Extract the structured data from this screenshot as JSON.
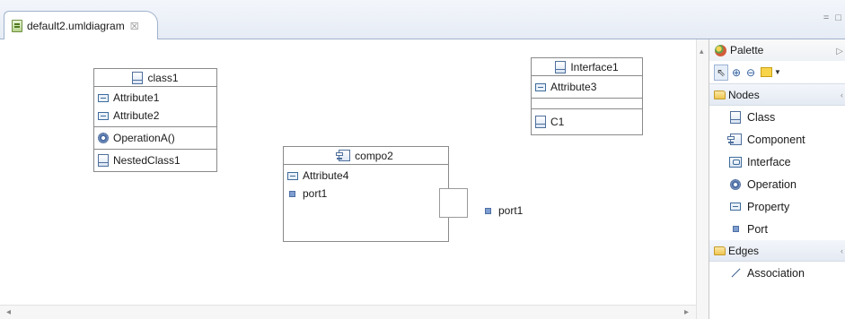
{
  "editor": {
    "tab_title": "default2.umldiagram",
    "tab_close_icon": "close-x-icon",
    "window_controls": "= □"
  },
  "diagram": {
    "class1": {
      "name": "class1",
      "attributes": [
        "Attribute1",
        "Attribute2"
      ],
      "operations": [
        "OperationA()"
      ],
      "nested_classes": [
        "NestedClass1"
      ]
    },
    "interface1": {
      "name": "Interface1",
      "attributes": [
        "Attribute3"
      ],
      "operations": [],
      "nested_classes": [
        "C1"
      ]
    },
    "compo2": {
      "name": "compo2",
      "attributes": [
        "Attribute4"
      ],
      "ports": [
        "port1"
      ]
    },
    "free_port": {
      "label": "port1"
    }
  },
  "palette": {
    "title": "Palette",
    "tools": [
      "select-arrow-icon",
      "zoom-in-icon",
      "zoom-out-icon",
      "note-icon"
    ],
    "nodes_drawer": {
      "label": "Nodes",
      "items": [
        {
          "label": "Class",
          "icon": "class-icon"
        },
        {
          "label": "Component",
          "icon": "component-icon"
        },
        {
          "label": "Interface",
          "icon": "interface-icon"
        },
        {
          "label": "Operation",
          "icon": "operation-icon"
        },
        {
          "label": "Property",
          "icon": "property-icon"
        },
        {
          "label": "Port",
          "icon": "port-icon"
        }
      ]
    },
    "edges_drawer": {
      "label": "Edges",
      "items": [
        {
          "label": "Association",
          "icon": "association-icon"
        }
      ]
    }
  },
  "colors": {
    "accent_blue": "#4f6f9c",
    "border_gray": "#8a8a8a",
    "tab_border": "#9fb2cc",
    "note_yellow": "#f7d44a"
  }
}
